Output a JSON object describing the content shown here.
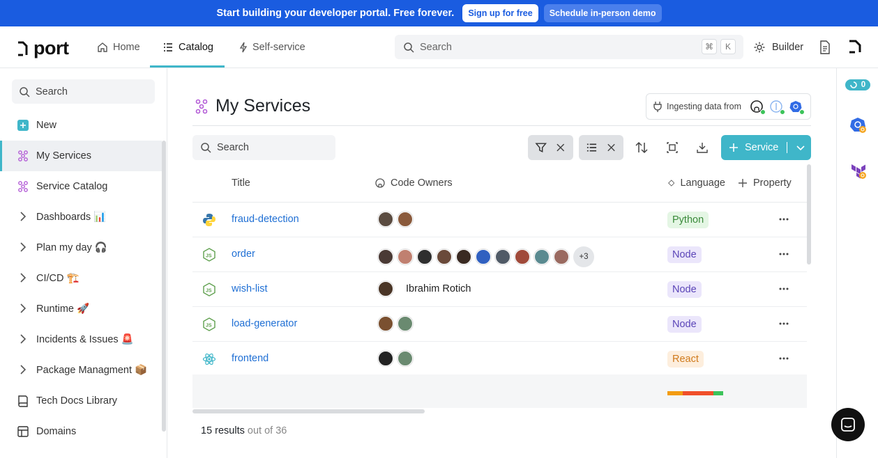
{
  "banner": {
    "text": "Start building your developer portal. Free forever.",
    "signup_label": "Sign up for free",
    "demo_label": "Schedule in-person demo"
  },
  "topnav": {
    "logo": "port",
    "tabs": [
      {
        "label": "Home",
        "icon": "home-icon"
      },
      {
        "label": "Catalog",
        "icon": "catalog-icon",
        "active": true
      },
      {
        "label": "Self-service",
        "icon": "lightning-icon"
      }
    ],
    "search_placeholder": "Search",
    "shortcut_keys": [
      "⌘",
      "K"
    ],
    "builder_label": "Builder"
  },
  "sidebar": {
    "search_placeholder": "Search",
    "items": [
      {
        "label": "New",
        "icon": "plus-square-icon"
      },
      {
        "label": "My Services",
        "icon": "blueprint-icon",
        "active": true
      },
      {
        "label": "Service Catalog",
        "icon": "blueprint-icon"
      },
      {
        "label": "Dashboards 📊",
        "icon": "chevron-right-icon"
      },
      {
        "label": "Plan my day 🎧",
        "icon": "chevron-right-icon"
      },
      {
        "label": "CI/CD 🏗️",
        "icon": "chevron-right-icon"
      },
      {
        "label": "Runtime 🚀",
        "icon": "chevron-right-icon"
      },
      {
        "label": "Incidents & Issues 🚨",
        "icon": "chevron-right-icon"
      },
      {
        "label": "Package Managment 📦",
        "icon": "chevron-right-icon"
      },
      {
        "label": "Tech Docs Library",
        "icon": "book-icon"
      },
      {
        "label": "Domains",
        "icon": "table-icon"
      }
    ]
  },
  "rail": {
    "running_count": "0"
  },
  "page": {
    "title": "My Services",
    "ingest_label": "Ingesting data from",
    "search_placeholder": "Search",
    "add_button_label": "Service"
  },
  "table": {
    "columns": [
      "Title",
      "Code Owners",
      "Language",
      "Property"
    ],
    "rows": [
      {
        "title": "fraud-detection",
        "icon": "python-icon",
        "owners": 2,
        "owner_name": "",
        "extra": "",
        "language": "Python"
      },
      {
        "title": "order",
        "icon": "nodejs-icon",
        "owners": 10,
        "owner_name": "",
        "extra": "+3",
        "language": "Node"
      },
      {
        "title": "wish-list",
        "icon": "nodejs-icon",
        "owners": 1,
        "owner_name": "Ibrahim Rotich",
        "extra": "",
        "language": "Node"
      },
      {
        "title": "load-generator",
        "icon": "nodejs-icon",
        "owners": 2,
        "owner_name": "",
        "extra": "",
        "language": "Node"
      },
      {
        "title": "frontend",
        "icon": "react-icon",
        "owners": 2,
        "owner_name": "",
        "extra": "",
        "language": "React"
      }
    ],
    "language_colors": {
      "Python": {
        "bg": "#e4f6e4",
        "fg": "#3a8a3a"
      },
      "Node": {
        "bg": "#ebe6fb",
        "fg": "#5b45b8"
      },
      "React": {
        "bg": "#fdeedd",
        "fg": "#d07a1c"
      }
    }
  },
  "results": {
    "count": "15 results",
    "total": "out of 36"
  },
  "colors": {
    "banner": "#1a5ce0",
    "accent": "#3fb6c9",
    "link": "#1f6fd4"
  }
}
